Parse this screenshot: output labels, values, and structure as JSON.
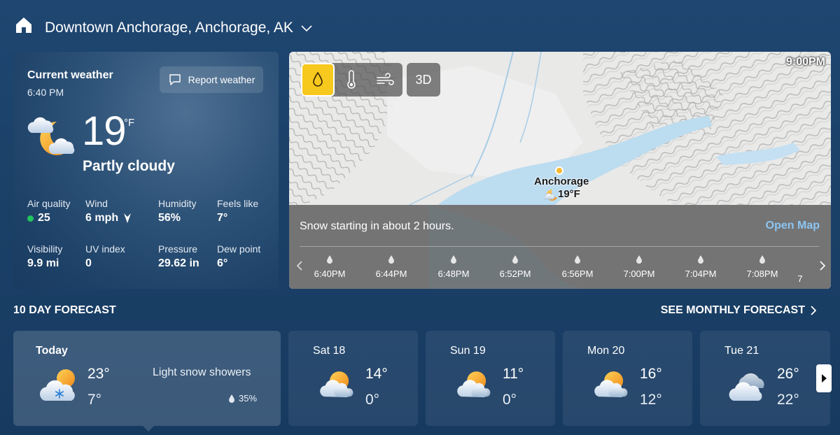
{
  "header": {
    "location": "Downtown Anchorage, Anchorage, AK"
  },
  "current": {
    "title": "Current weather",
    "time": "6:40 PM",
    "report_label": "Report weather",
    "temperature": "19",
    "unit": "°F",
    "condition": "Partly cloudy",
    "icon": "partly-cloudy-night-icon",
    "metrics": [
      {
        "label": "Air quality",
        "value": "25"
      },
      {
        "label": "Wind",
        "value": "6 mph"
      },
      {
        "label": "Humidity",
        "value": "56%"
      },
      {
        "label": "Feels like",
        "value": "7°"
      },
      {
        "label": "Visibility",
        "value": "9.9 mi"
      },
      {
        "label": "UV index",
        "value": "0"
      },
      {
        "label": "Pressure",
        "value": "29.62 in"
      },
      {
        "label": "Dew point",
        "value": "6°"
      }
    ],
    "aqi_color": "#22c55e"
  },
  "map": {
    "time": "9:00PM",
    "layers": [
      "precipitation-icon",
      "temperature-icon",
      "wind-icon"
    ],
    "active_layer": "precipitation-icon",
    "btn_3d": "3D",
    "city": "Anchorage",
    "city_temp": "19°F",
    "message": "Snow starting in about 2 hours.",
    "open_map": "Open Map",
    "timeline": [
      "6:40PM",
      "6:44PM",
      "6:48PM",
      "6:52PM",
      "6:56PM",
      "7:00PM",
      "7:04PM",
      "7:08PM",
      "7"
    ]
  },
  "forecast": {
    "title": "10 DAY FORECAST",
    "monthly": "SEE MONTHLY FORECAST",
    "days": [
      {
        "name": "Today",
        "hi": "23°",
        "lo": "7°",
        "condition": "Light snow showers",
        "precip": "35%",
        "icon": "snow-showers-icon"
      },
      {
        "name": "Sat 18",
        "hi": "14°",
        "lo": "0°",
        "icon": "partly-sunny-icon"
      },
      {
        "name": "Sun 19",
        "hi": "11°",
        "lo": "0°",
        "icon": "partly-sunny-icon"
      },
      {
        "name": "Mon 20",
        "hi": "16°",
        "lo": "12°",
        "icon": "partly-sunny-icon"
      },
      {
        "name": "Tue 21",
        "hi": "26°",
        "lo": "22°",
        "icon": "mostly-cloudy-icon"
      }
    ]
  },
  "colors": {
    "accent_link": "#8cc5f2",
    "active_layer": "#f7c81e",
    "sun": "#f5a623"
  }
}
